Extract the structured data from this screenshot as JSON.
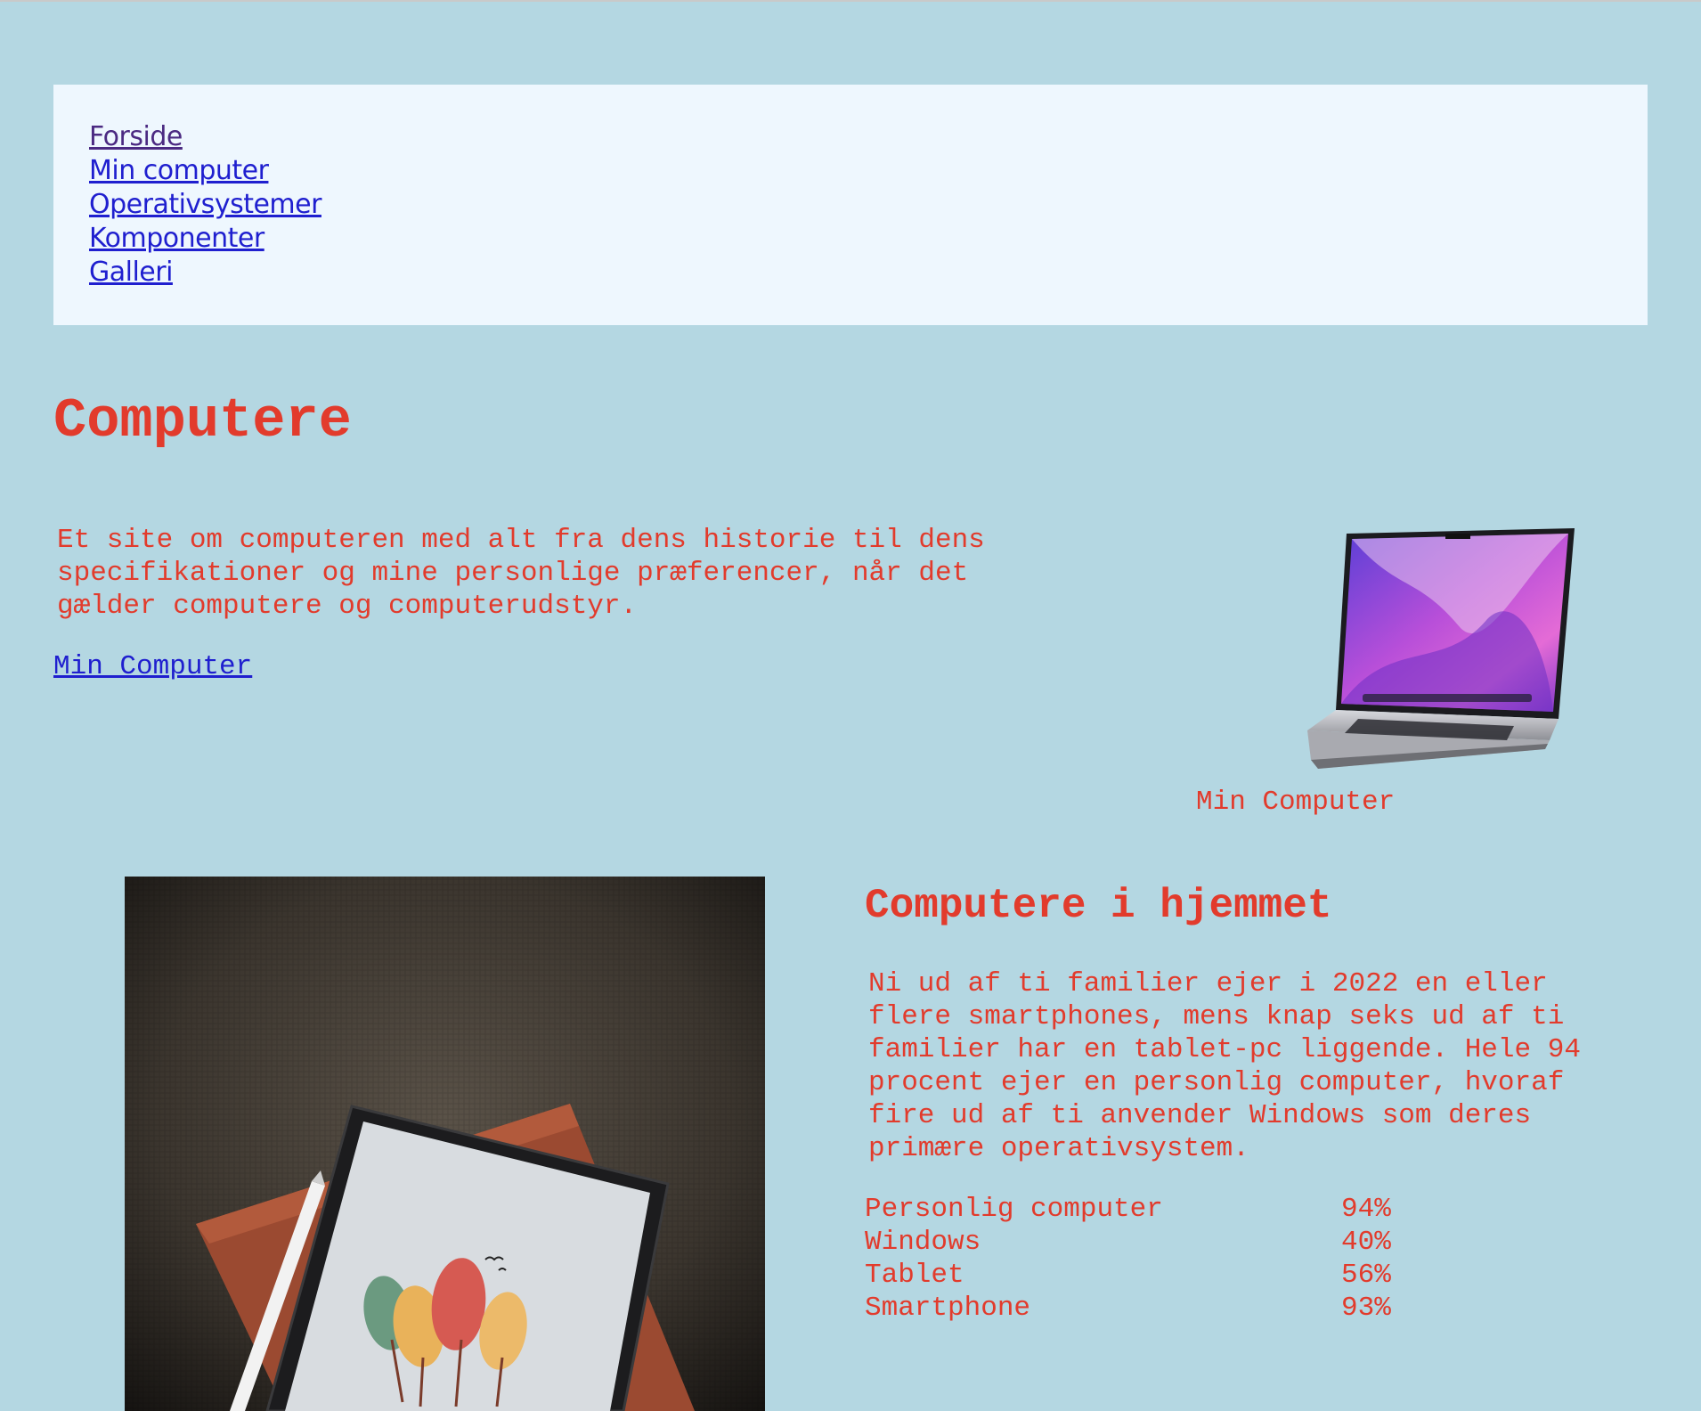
{
  "nav": {
    "items": [
      {
        "label": "Forside"
      },
      {
        "label": "Min computer"
      },
      {
        "label": "Operativsystemer"
      },
      {
        "label": "Komponenter"
      },
      {
        "label": "Galleri"
      }
    ]
  },
  "header": {
    "title": "Computere"
  },
  "intro": {
    "text": "Et site om computeren med alt fra dens historie til dens specifikationer og mine personlige præferencer, når det gælder computere og computerudstyr.",
    "link": "Min Computer"
  },
  "laptop": {
    "caption": "Min Computer"
  },
  "home_section": {
    "title": "Computere i hjemmet",
    "text": "Ni ud af ti familier ejer i 2022 en eller flere smartphones, mens knap seks ud af ti familier har en tablet-pc liggende. Hele 94 procent ejer en personlig computer, hvoraf fire ud af ti anvender Windows som deres primære operativsystem.",
    "stats": [
      {
        "label": "Personlig computer",
        "value": "94%"
      },
      {
        "label": "Windows",
        "value": "40%"
      },
      {
        "label": "Tablet",
        "value": "56%"
      },
      {
        "label": "Smartphone",
        "value": "93%"
      }
    ]
  },
  "colors": {
    "background": "#b4d7e2",
    "nav_background": "#eef7fe",
    "text_red": "#e23b2c",
    "link_blue": "#1f1fcf",
    "link_visited": "#4b2a82"
  }
}
